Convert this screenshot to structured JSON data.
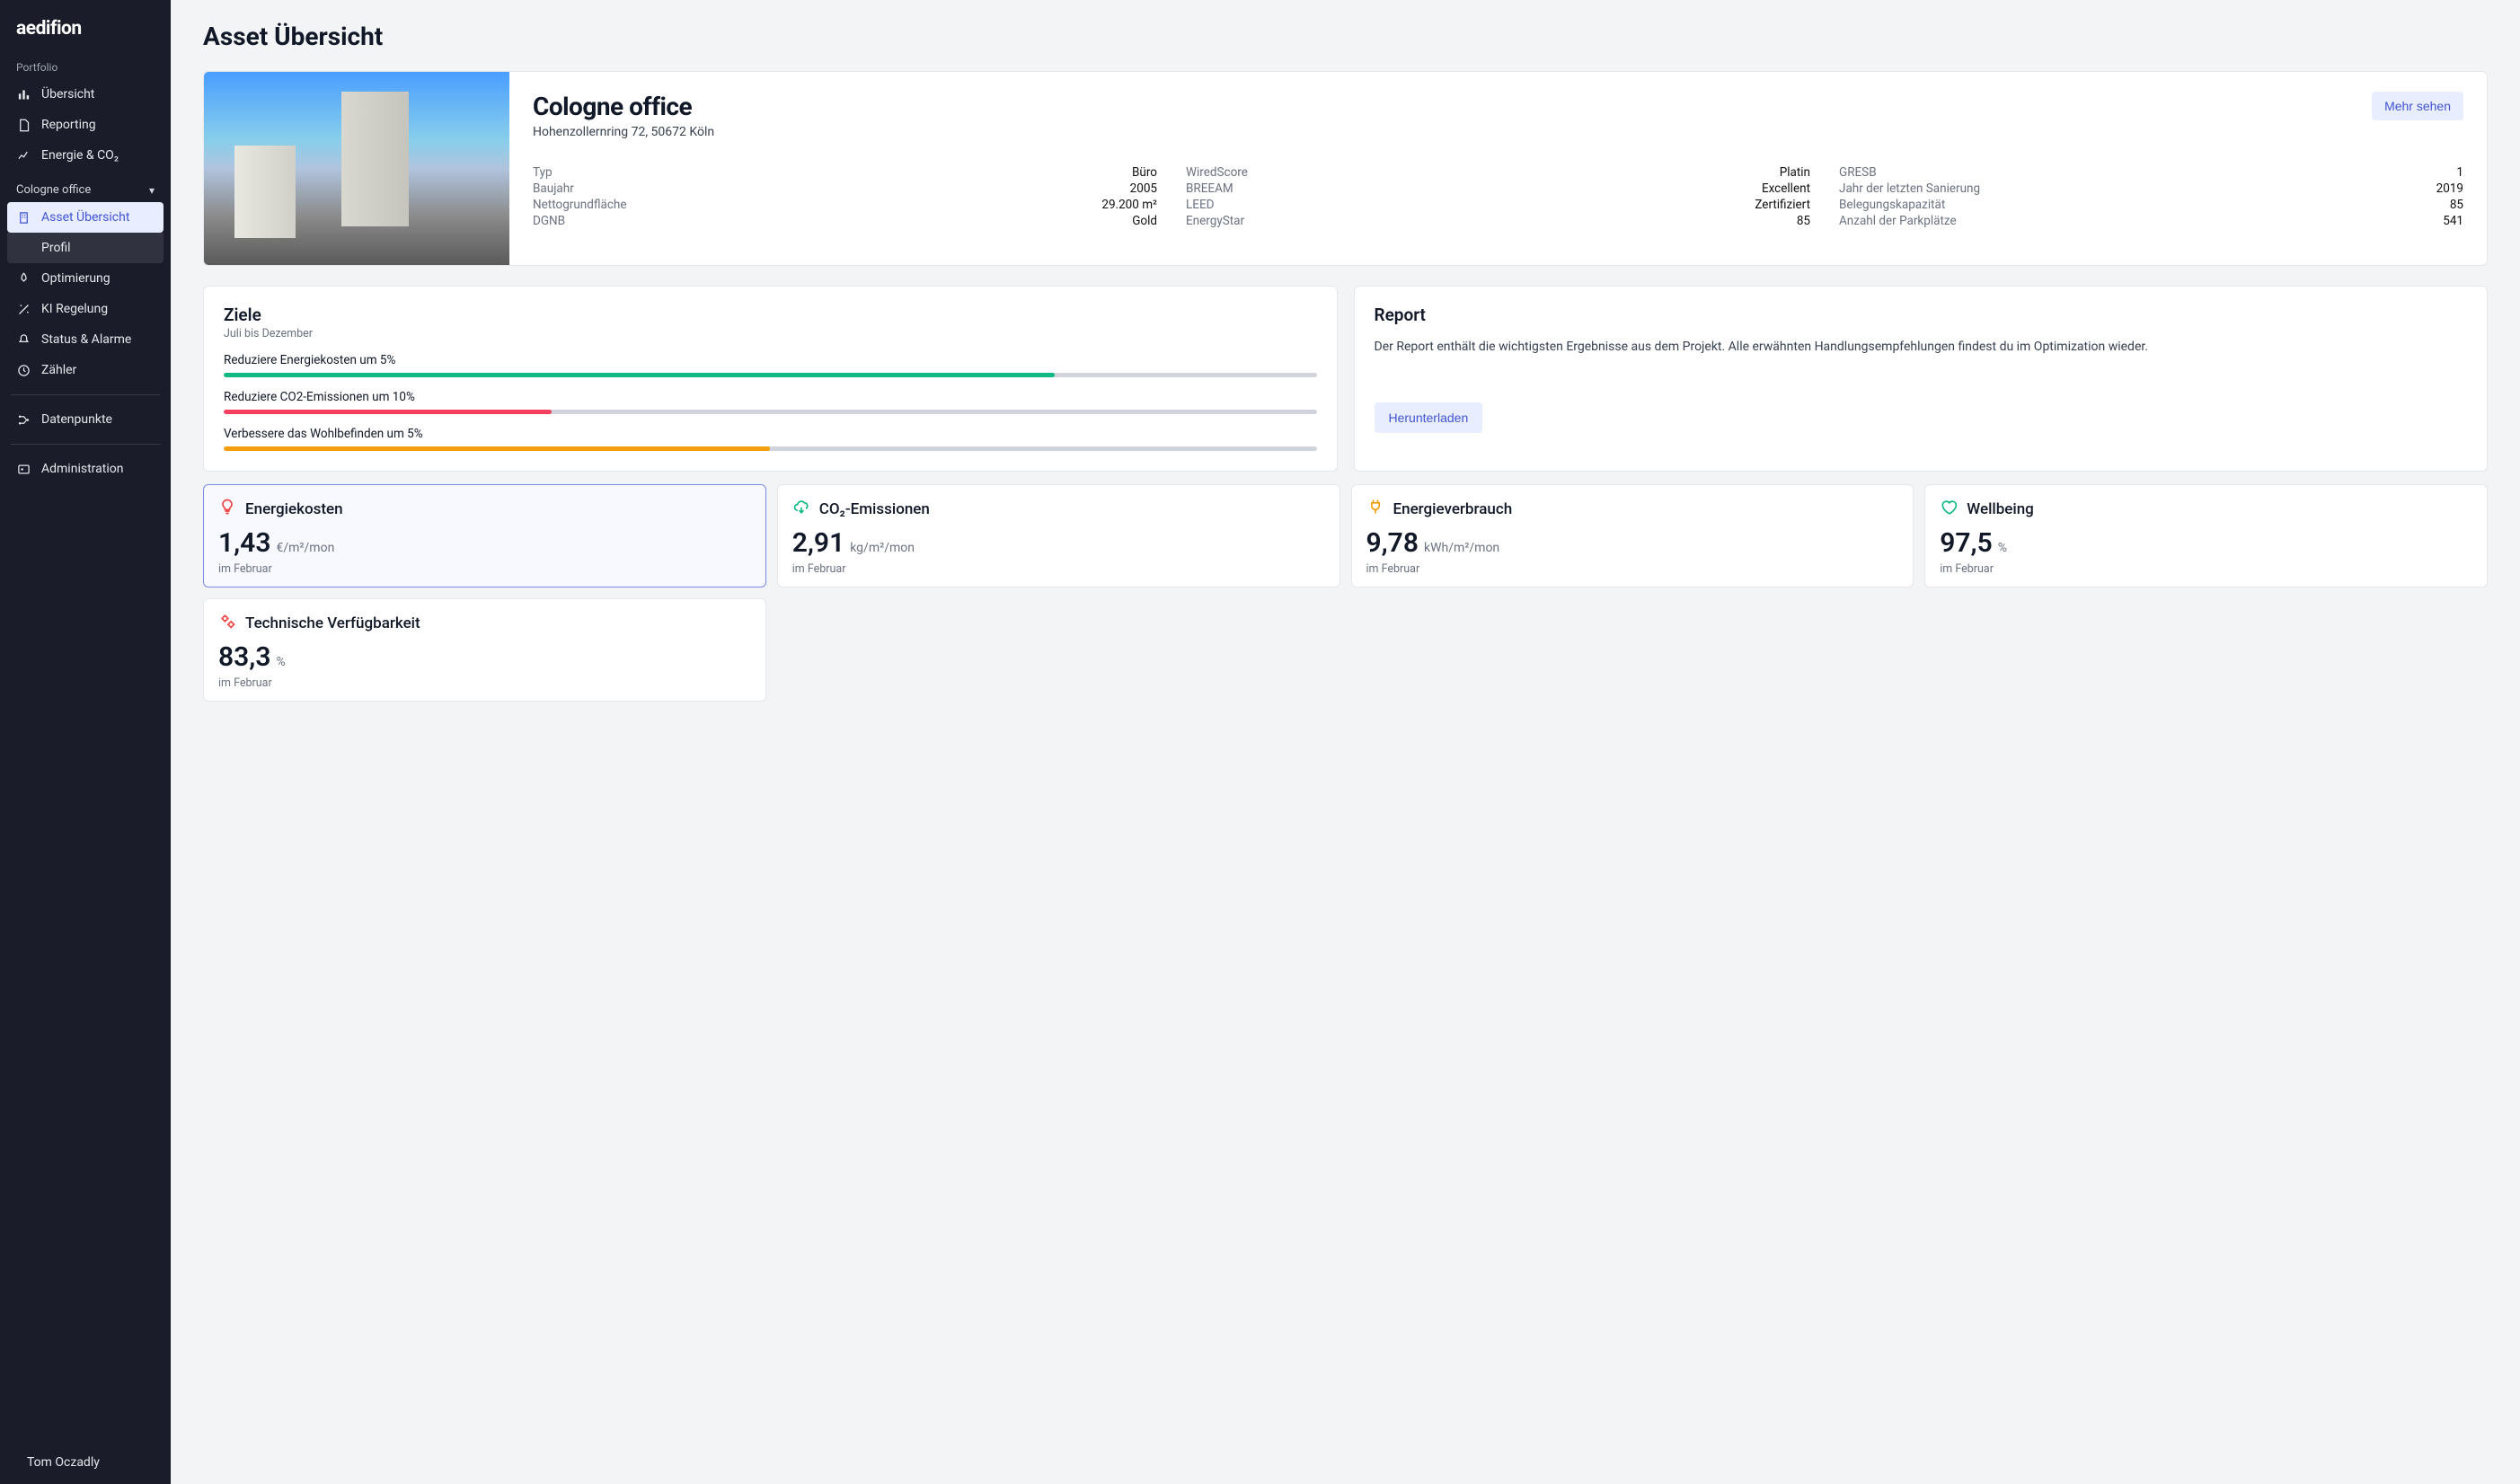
{
  "brand": "aedifion",
  "sidebar": {
    "section1": "Portfolio",
    "items1": [
      {
        "label": "Übersicht",
        "icon": "chart"
      },
      {
        "label": "Reporting",
        "icon": "doc"
      },
      {
        "label": "Energie & CO₂",
        "icon": "line"
      }
    ],
    "project": "Cologne office",
    "projectItems": [
      {
        "label": "Asset Übersicht",
        "icon": "building",
        "active": true
      },
      {
        "label": "Profil",
        "sub": true
      },
      {
        "label": "Optimierung",
        "icon": "rocket"
      },
      {
        "label": "KI Regelung",
        "icon": "wand"
      },
      {
        "label": "Status & Alarme",
        "icon": "bell"
      },
      {
        "label": "Zähler",
        "icon": "clock"
      }
    ],
    "items3": [
      {
        "label": "Datenpunkte",
        "icon": "nodes"
      }
    ],
    "items4": [
      {
        "label": "Administration",
        "icon": "id"
      }
    ]
  },
  "user": "Tom Oczadly",
  "page": {
    "title": "Asset Übersicht",
    "assetName": "Cologne office",
    "assetAddress": "Hohenzollernring 72, 50672 Köln",
    "moreBtn": "Mehr sehen",
    "props": [
      [
        {
          "l": "Typ",
          "v": "Büro"
        },
        {
          "l": "Baujahr",
          "v": "2005"
        },
        {
          "l": "Nettogrundfläche",
          "v": "29.200 m²"
        },
        {
          "l": "DGNB",
          "v": "Gold"
        }
      ],
      [
        {
          "l": "WiredScore",
          "v": "Platin"
        },
        {
          "l": "BREEAM",
          "v": "Excellent"
        },
        {
          "l": "LEED",
          "v": "Zertifiziert"
        },
        {
          "l": "EnergyStar",
          "v": "85"
        }
      ],
      [
        {
          "l": "GRESB",
          "v": "1"
        },
        {
          "l": "Jahr der letzten Sanierung",
          "v": "2019"
        },
        {
          "l": "Belegungskapazität",
          "v": "85"
        },
        {
          "l": "Anzahl der Parkplätze",
          "v": "541"
        }
      ]
    ],
    "goals": {
      "title": "Ziele",
      "sub": "Juli bis Dezember",
      "items": [
        {
          "label": "Reduziere Energiekosten um 5%",
          "pct": 76,
          "color": "#10b981"
        },
        {
          "label": "Reduziere CO2-Emissionen um 10%",
          "pct": 30,
          "color": "#f43f5e"
        },
        {
          "label": "Verbessere das Wohlbefinden um 5%",
          "pct": 50,
          "color": "#f59e0b"
        }
      ]
    },
    "report": {
      "title": "Report",
      "text": "Der Report enthält die wichtigsten Ergebnisse aus dem Projekt. Alle erwähnten Handlungsempfehlungen findest du im Optimization wieder.",
      "btn": "Herunterladen"
    },
    "kpis": [
      {
        "title": "Energiekosten",
        "value": "1,43",
        "unit": "€/m²/mon",
        "sub": "im Februar",
        "color": "#ef4444",
        "icon": "bulb",
        "selected": true
      },
      {
        "title": "CO₂-Emissionen",
        "value": "2,91",
        "unit": "kg/m²/mon",
        "sub": "im Februar",
        "color": "#10b981",
        "icon": "cloud"
      },
      {
        "title": "Energieverbrauch",
        "value": "9,78",
        "unit": "kWh/m²/mon",
        "sub": "im Februar",
        "color": "#f59e0b",
        "icon": "plug"
      },
      {
        "title": "Wellbeing",
        "value": "97,5",
        "unit": "%",
        "sub": "im Februar",
        "color": "#10b981",
        "icon": "heart"
      }
    ],
    "kpis2": [
      {
        "title": "Technische Verfügbarkeit",
        "value": "83,3",
        "unit": "%",
        "sub": "im Februar",
        "color": "#ef4444",
        "icon": "gears"
      }
    ]
  }
}
